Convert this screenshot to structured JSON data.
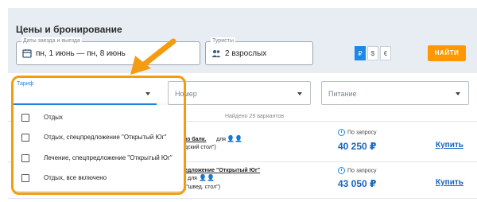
{
  "panel": {
    "title": "Цены и бронирование"
  },
  "dates": {
    "label": "Даты заезда и выезда",
    "value": "пн, 1 июнь — пн, 8 июнь",
    "icon": "calendar-icon"
  },
  "tourists": {
    "label": "Туристы",
    "value": "2 взрослых",
    "icon": "people-icon"
  },
  "currency": {
    "options": [
      "₽",
      "$",
      "€"
    ],
    "selected": "₽",
    "accent": "#1e88e5"
  },
  "find_button": {
    "label": "НАЙТИ",
    "color": "#ff9800"
  },
  "filters": {
    "tariff_label": "Тариф",
    "room_placeholder": "Номер",
    "meal_placeholder": "Питание"
  },
  "results": {
    "found_text": "Найдено 29 вариантов",
    "offers": [
      {
        "line1": "эз балк.",
        "line1b": "для",
        "line2": "дский стол\")",
        "on_request": "По запросу",
        "price": "40 250 ₽",
        "buy": "Купить"
      },
      {
        "line1": "едложение \"Открытый Юг\"",
        "line2": "для",
        "line3": "(\"швед. стол\")",
        "on_request": "По запросу",
        "price": "43 050 ₽",
        "buy": "Купить"
      }
    ]
  },
  "tariff_dropdown": {
    "items": [
      "Отдых",
      "Отдых, спецпредложение \"Открытый Юг\"",
      "Лечение, спецпредложение \"Открытый Юг\"",
      "Отдых, все включено"
    ]
  },
  "annotation": {
    "highlight_color": "#f39c12"
  }
}
